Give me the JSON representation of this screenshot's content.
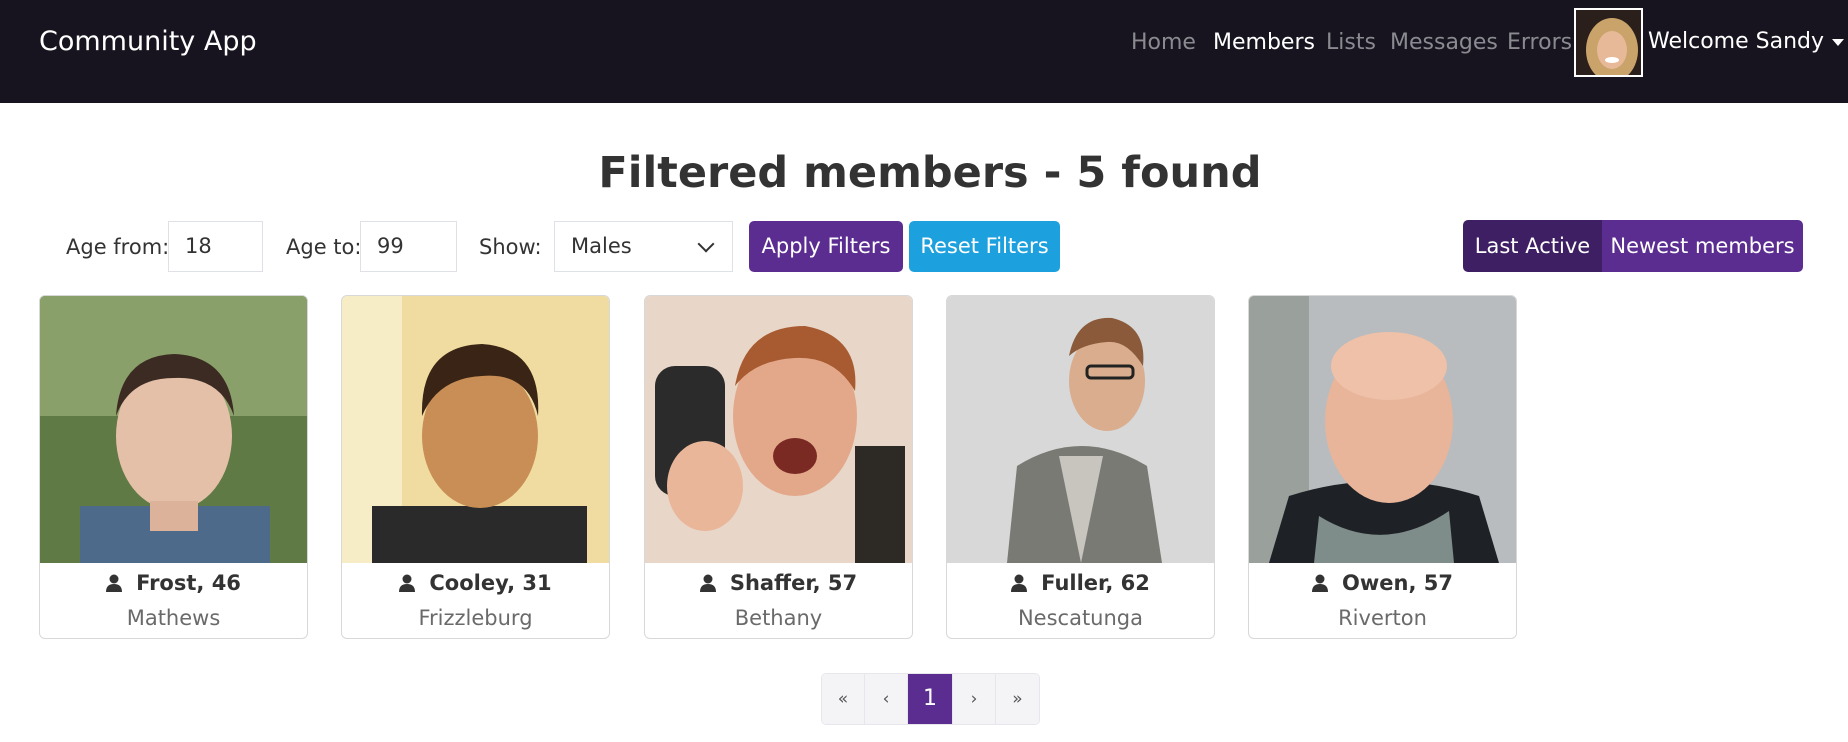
{
  "app": {
    "title": "Community App"
  },
  "nav": {
    "items": [
      {
        "label": "Home"
      },
      {
        "label": "Members"
      },
      {
        "label": "Lists"
      },
      {
        "label": "Messages"
      },
      {
        "label": "Errors"
      }
    ],
    "active": "Members",
    "welcome": "Welcome Sandy"
  },
  "page": {
    "title": "Filtered members - 5 found"
  },
  "filters": {
    "age_from_label": "Age from:",
    "age_from_value": "18",
    "age_to_label": "Age to:",
    "age_to_value": "99",
    "show_label": "Show:",
    "show_value": "Males",
    "apply_label": "Apply Filters",
    "reset_label": "Reset Filters"
  },
  "sort": {
    "last_active_label": "Last Active",
    "newest_label": "Newest members",
    "selected": "Last Active"
  },
  "members": [
    {
      "name": "Frost, 46",
      "city": "Mathews"
    },
    {
      "name": "Cooley, 31",
      "city": "Frizzleburg"
    },
    {
      "name": "Shaffer, 57",
      "city": "Bethany"
    },
    {
      "name": "Fuller, 62",
      "city": "Nescatunga"
    },
    {
      "name": "Owen, 57",
      "city": "Riverton"
    }
  ],
  "pagination": {
    "first": "«",
    "prev": "‹",
    "current": "1",
    "next": "›",
    "last": "»"
  },
  "colors": {
    "navbar": "#17141f",
    "primary": "#5c2d91",
    "primary_dark": "#3e1f63",
    "info": "#1da1de"
  }
}
